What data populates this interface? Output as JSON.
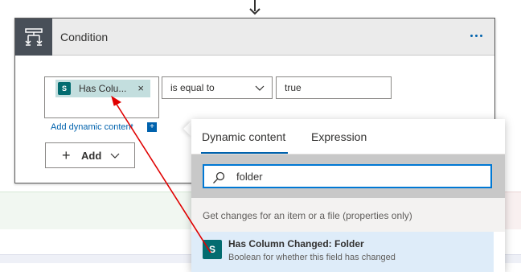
{
  "condition": {
    "title": "Condition",
    "token_label": "Has Colu...",
    "token_remove": "×",
    "token_icon": "sharepoint-icon",
    "operator": "is equal to",
    "value": "true",
    "add_dynamic_label": "Add dynamic content",
    "add_dynamic_plus": "+",
    "add_button_label": "Add",
    "add_button_plus": "+"
  },
  "flyout": {
    "tabs": [
      "Dynamic content",
      "Expression"
    ],
    "active_tab": "Dynamic content",
    "search_value": "folder",
    "group_header": "Get changes for an item or a file (properties only)",
    "result": {
      "title": "Has Column Changed: Folder",
      "description": "Boolean for whether this field has changed",
      "icon": "sharepoint-icon"
    }
  },
  "colors": {
    "accent": "#0062ad",
    "token_bg": "#c3dede",
    "sharepoint": "#036c70",
    "annotation_arrow": "#e00000"
  }
}
